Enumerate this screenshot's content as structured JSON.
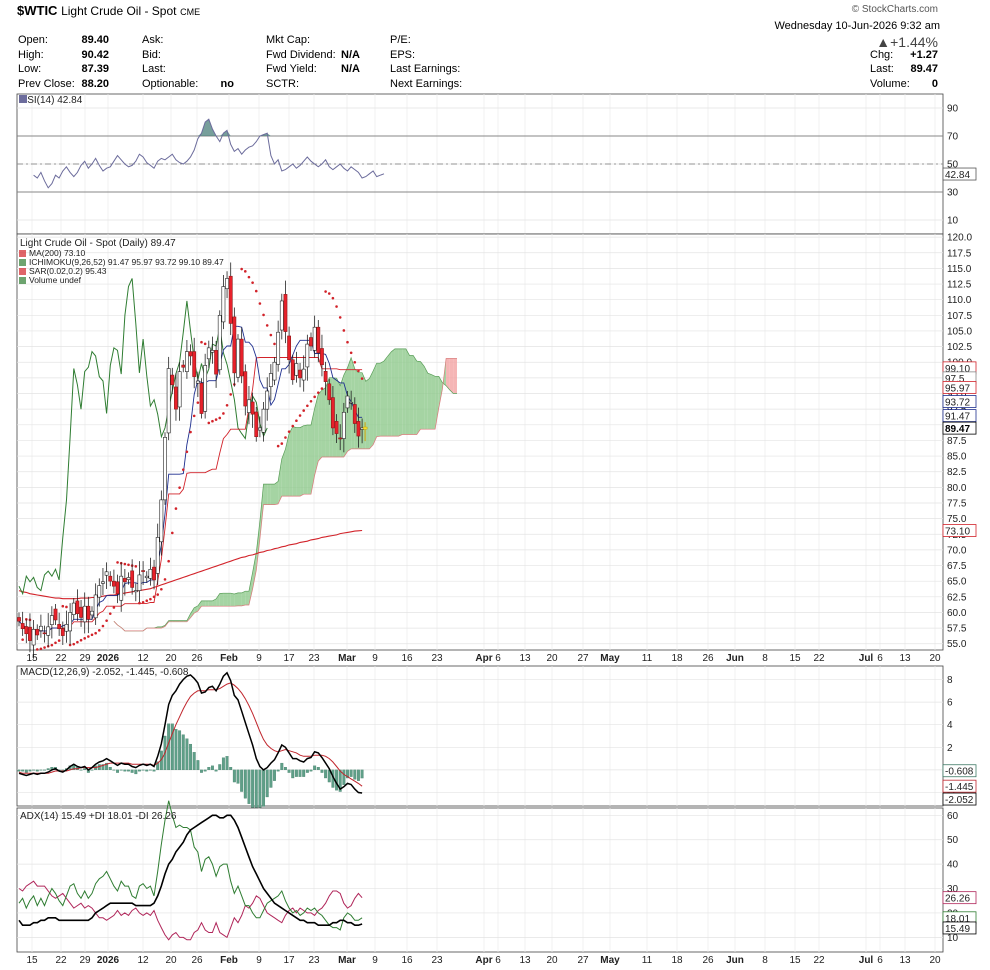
{
  "header": {
    "symbol": "$WTIC",
    "name": "Light Crude Oil - Spot",
    "exchange": "CME",
    "brand": "© StockCharts.com",
    "date": "Wednesday  10-Jun-2026  9:32 am",
    "pct_change": "▲+1.44%",
    "col1": [
      [
        "Open:",
        "89.40"
      ],
      [
        "High:",
        "90.42"
      ],
      [
        "Low:",
        "87.39"
      ],
      [
        "Prev Close:",
        "88.20"
      ]
    ],
    "col2": [
      [
        "Ask:",
        ""
      ],
      [
        "Bid:",
        ""
      ],
      [
        "Last:",
        ""
      ],
      [
        "Optionable:",
        "no"
      ]
    ],
    "col3": [
      [
        "Mkt Cap:",
        ""
      ],
      [
        "Fwd Dividend:",
        "N/A"
      ],
      [
        "Fwd Yield:",
        "N/A"
      ],
      [
        "SCTR:",
        ""
      ]
    ],
    "col4": [
      [
        "P/E:",
        ""
      ],
      [
        "EPS:",
        ""
      ],
      [
        "Last Earnings:",
        ""
      ],
      [
        "Next Earnings:",
        ""
      ]
    ],
    "col5": [
      [
        "Chg:",
        "+1.27"
      ],
      [
        "Last:",
        "89.47"
      ],
      [
        "Volume:",
        "0"
      ]
    ]
  },
  "colors": {
    "up": "#ffffff",
    "down": "#e8212b",
    "ma200": "#d2232a",
    "tenkan": "#1e2f8f",
    "kijun": "#d2232a",
    "chikou": "#2f7d32",
    "cloud_up": "#8fc98c",
    "cloud_down": "#f2a3a3",
    "sar": "#d2232a",
    "macd": "#000000",
    "signal": "#c0262d",
    "hist": "#5f9f88",
    "adx": "#000000",
    "pdi": "#2f7d32",
    "ndi": "#b0265a",
    "rsi": "#6c6c9c",
    "highlight": "#ffef3a"
  },
  "chart_data": [
    {
      "type": "line",
      "title": "RSI(14) 42.84",
      "series": [
        {
          "name": "RSI(14)",
          "values": [
            42,
            40,
            44,
            38,
            33,
            36,
            42,
            40,
            45,
            48,
            44,
            41,
            44,
            49,
            52,
            47,
            50,
            54,
            49,
            45,
            47,
            48,
            52,
            56,
            53,
            50,
            48,
            49,
            52,
            57,
            55,
            51,
            49,
            47,
            52,
            54,
            53,
            55,
            57,
            53,
            51,
            50,
            52,
            55,
            60,
            68,
            72,
            80,
            82,
            75,
            70,
            66,
            72,
            74,
            64,
            59,
            61,
            57,
            60,
            62,
            63,
            66,
            70,
            71,
            72,
            56,
            50,
            53,
            45,
            46,
            48,
            50,
            47,
            49,
            52,
            55,
            52,
            50,
            48,
            50,
            53,
            48,
            46,
            48,
            50,
            47,
            45,
            48,
            46,
            44,
            40,
            41,
            43,
            45,
            41,
            42,
            43
          ]
        }
      ],
      "y_ticks": [
        10,
        30,
        50,
        70,
        90
      ],
      "ylim": [
        0,
        100
      ],
      "last_label": "42.84"
    },
    {
      "type": "candlestick",
      "title": "Light Crude Oil - Spot (Daily) 89.47",
      "legend": [
        "MA(200) 73.10",
        "ICHIMOKU(9,26,52) 91.47 95.97 93.72 99.10 89.47",
        "SAR(0.02,0.2) 95.43",
        "Volume undef"
      ],
      "y_ticks": [
        55.0,
        57.5,
        60.0,
        62.5,
        65.0,
        67.5,
        70.0,
        72.5,
        75.0,
        77.5,
        80.0,
        82.5,
        85.0,
        87.5,
        90.0,
        92.5,
        95.0,
        97.5,
        100.0,
        102.5,
        105.0,
        107.5,
        110.0,
        112.5,
        115.0,
        117.5,
        120.0
      ],
      "ylim": [
        54,
        120.5
      ],
      "right_labels": [
        "99.10",
        "97.5",
        "95.97",
        "93.72",
        "91.47",
        "89.47",
        "73.10"
      ],
      "x_ticks": [
        "15",
        "22",
        "29",
        "2026",
        "12",
        "20",
        "26",
        "Feb",
        "9",
        "17",
        "23",
        "Mar",
        "9",
        "16",
        "23",
        "Apr",
        "6",
        "13",
        "20",
        "27",
        "May",
        "11",
        "18",
        "26",
        "Jun",
        "8",
        "15",
        "22",
        "Jul",
        "6",
        "13",
        "20"
      ],
      "closes": [
        58.6,
        57.4,
        56.6,
        55.5,
        57.3,
        56.4,
        57.8,
        56.7,
        57.7,
        59.5,
        58.8,
        57.4,
        56.3,
        58.1,
        60.0,
        61.5,
        59.8,
        59.2,
        61.0,
        58.9,
        60.2,
        62.8,
        64.3,
        64.9,
        66.5,
        65.0,
        64.2,
        63.0,
        65.8,
        64.9,
        65.6,
        64.0,
        63.5,
        66.0,
        66.6,
        65.8,
        66.9,
        65.2,
        72.0,
        78.0,
        88.0,
        99.0,
        96.4,
        92.5,
        98.5,
        99.2,
        101.7,
        101.0,
        97.7,
        97.0,
        91.8,
        99.5,
        102.3,
        101.9,
        98.1,
        107.5,
        112.1,
        113.4,
        106.2,
        98.3,
        103.7,
        97.8,
        93.0,
        94.0,
        91.7,
        88.1,
        89.5,
        92.5,
        95.4,
        98.2,
        100.0,
        104.8,
        109.8,
        104.9,
        100.4,
        97.2,
        99.8,
        97.5,
        98.9,
        102.9,
        102.6,
        105.6,
        101.5,
        99.6,
        96.9,
        94.0,
        89.5,
        88.6,
        87.8,
        92.0,
        94.6,
        93.6,
        90.2,
        88.2,
        89.5
      ],
      "ma200": [
        63.5,
        63.3,
        63.2,
        63.0,
        62.9,
        62.8,
        62.7,
        62.6,
        62.5,
        62.4,
        62.3,
        62.3,
        62.2,
        62.2,
        62.2,
        62.2,
        62.2,
        62.3,
        62.3,
        62.3,
        62.4,
        62.4,
        62.5,
        62.6,
        62.7,
        62.8,
        62.8,
        62.9,
        63.0,
        63.1,
        63.2,
        63.3,
        63.4,
        63.5,
        63.6,
        63.7,
        63.8,
        64.0,
        64.2,
        64.4,
        64.6,
        64.8,
        65.0,
        65.2,
        65.4,
        65.6,
        65.8,
        66.0,
        66.2,
        66.4,
        66.6,
        66.8,
        67.0,
        67.2,
        67.4,
        67.6,
        67.8,
        68.0,
        68.2,
        68.4,
        68.6,
        68.8,
        68.9,
        69.1,
        69.2,
        69.4,
        69.6,
        69.7,
        69.9,
        70.0,
        70.2,
        70.3,
        70.5,
        70.6,
        70.8,
        70.9,
        71.0,
        71.2,
        71.3,
        71.4,
        71.6,
        71.7,
        71.8,
        72.0,
        72.1,
        72.2,
        72.3,
        72.4,
        72.6,
        72.7,
        72.8,
        72.9,
        73.0,
        73.05,
        73.1
      ],
      "last": 89.47,
      "ma200_last": 73.1
    },
    {
      "type": "bar+line",
      "title": "MACD(12,26,9) -2.052, -1.445, -0.608",
      "series": [
        {
          "name": "MACD(12,26,9)",
          "values": [
            -0.3,
            -0.4,
            -0.5,
            -0.4,
            -0.3,
            -0.4,
            -0.3,
            -0.3,
            -0.2,
            0.0,
            0.1,
            -0.1,
            -0.2,
            0.0,
            0.3,
            0.5,
            0.3,
            0.2,
            0.3,
            0.0,
            0.2,
            0.5,
            0.7,
            0.8,
            1.0,
            0.8,
            0.6,
            0.4,
            0.6,
            0.5,
            0.5,
            0.3,
            0.2,
            0.4,
            0.5,
            0.4,
            0.5,
            0.3,
            1.2,
            2.3,
            4.0,
            5.8,
            6.6,
            7.0,
            7.6,
            8.0,
            8.3,
            8.4,
            8.1,
            7.7,
            6.8,
            6.9,
            7.3,
            7.4,
            7.0,
            7.6,
            8.3,
            8.6,
            7.9,
            6.6,
            6.2,
            5.2,
            4.2,
            3.2,
            2.2,
            1.0,
            0.3,
            0.0,
            0.2,
            0.6,
            0.9,
            1.5,
            2.2,
            2.0,
            1.5,
            1.0,
            1.0,
            0.8,
            0.7,
            1.0,
            1.1,
            1.6,
            1.5,
            1.1,
            0.6,
            0.1,
            -0.6,
            -1.2,
            -1.7,
            -1.5,
            -1.2,
            -1.3,
            -1.7,
            -2.0,
            -2.05
          ]
        },
        {
          "name": "Signal",
          "values": [
            -0.2,
            -0.3,
            -0.3,
            -0.3,
            -0.3,
            -0.3,
            -0.3,
            -0.3,
            -0.3,
            -0.2,
            -0.1,
            -0.1,
            -0.1,
            -0.1,
            0.0,
            0.1,
            0.1,
            0.2,
            0.2,
            0.2,
            0.2,
            0.2,
            0.3,
            0.4,
            0.5,
            0.6,
            0.6,
            0.6,
            0.6,
            0.6,
            0.6,
            0.5,
            0.5,
            0.5,
            0.5,
            0.5,
            0.5,
            0.4,
            0.6,
            0.9,
            1.5,
            2.4,
            3.2,
            4.0,
            4.7,
            5.4,
            6.0,
            6.5,
            6.8,
            7.0,
            7.0,
            7.0,
            7.1,
            7.1,
            7.1,
            7.2,
            7.4,
            7.6,
            7.7,
            7.5,
            7.2,
            6.8,
            6.3,
            5.7,
            5.0,
            4.2,
            3.4,
            2.7,
            2.2,
            1.9,
            1.7,
            1.6,
            1.7,
            1.8,
            1.7,
            1.6,
            1.5,
            1.3,
            1.2,
            1.2,
            1.2,
            1.3,
            1.3,
            1.3,
            1.2,
            1.0,
            0.7,
            0.3,
            -0.1,
            -0.4,
            -0.6,
            -0.8,
            -1.0,
            -1.2,
            -1.445
          ]
        },
        {
          "name": "Histogram",
          "values": []
        }
      ],
      "y_ticks": [
        -2,
        0,
        2,
        4,
        6,
        8
      ],
      "ylim": [
        -3.2,
        9.2
      ],
      "right_labels": [
        "-0.608",
        "-1.445",
        "-2.052"
      ]
    },
    {
      "type": "line",
      "title": "ADX(14) 15.49 +DI 18.01 -DI 26.26",
      "series": [
        {
          "name": "ADX(14)",
          "values": [
            17,
            15,
            15,
            15,
            16,
            16,
            17,
            17,
            18,
            18,
            18,
            17,
            17,
            17,
            17,
            17,
            17,
            17,
            17,
            17,
            18,
            20,
            21,
            22,
            23,
            24,
            24,
            24,
            24,
            24,
            24,
            24,
            23,
            23,
            23,
            23,
            23,
            24,
            27,
            31,
            36,
            40,
            42,
            45,
            47,
            49,
            52,
            54,
            55,
            56,
            57,
            58,
            59,
            60,
            60,
            59,
            59,
            60,
            60,
            58,
            55,
            51,
            47,
            43,
            39,
            36,
            33,
            30,
            28,
            26,
            24,
            23,
            22,
            21,
            20,
            19,
            18,
            17,
            17,
            16,
            16,
            16,
            15,
            15,
            15,
            15,
            16,
            16,
            17,
            17,
            16,
            16,
            15,
            15,
            15.49
          ]
        },
        {
          "name": "+DI",
          "values": [
            24,
            26,
            22,
            25,
            27,
            23,
            26,
            23,
            27,
            30,
            28,
            25,
            23,
            27,
            31,
            32,
            28,
            26,
            29,
            26,
            28,
            32,
            34,
            35,
            37,
            34,
            31,
            29,
            33,
            31,
            31,
            27,
            26,
            31,
            32,
            30,
            31,
            27,
            37,
            48,
            58,
            66,
            60,
            55,
            56,
            55,
            55,
            54,
            47,
            45,
            37,
            42,
            43,
            40,
            35,
            39,
            40,
            40,
            33,
            28,
            31,
            27,
            23,
            23,
            20,
            18,
            18,
            21,
            24,
            25,
            26,
            27,
            29,
            25,
            22,
            20,
            21,
            19,
            20,
            22,
            21,
            22,
            20,
            19,
            17,
            15,
            14,
            14,
            13,
            18,
            20,
            19,
            17,
            17,
            18.01
          ]
        },
        {
          "name": "-DI",
          "values": [
            30,
            29,
            31,
            32,
            33,
            31,
            31,
            31,
            29,
            27,
            26,
            27,
            28,
            26,
            24,
            22,
            23,
            24,
            22,
            23,
            22,
            20,
            18,
            18,
            17,
            18,
            19,
            21,
            19,
            20,
            19,
            21,
            22,
            20,
            19,
            20,
            19,
            21,
            17,
            14,
            11,
            9,
            11,
            12,
            10,
            10,
            9,
            9,
            12,
            13,
            16,
            13,
            12,
            12,
            16,
            12,
            11,
            10,
            14,
            18,
            16,
            19,
            23,
            22,
            24,
            27,
            26,
            23,
            20,
            19,
            18,
            17,
            16,
            19,
            21,
            22,
            20,
            22,
            21,
            20,
            20,
            19,
            21,
            22,
            24,
            27,
            29,
            29,
            28,
            24,
            22,
            23,
            26,
            28,
            26.26
          ]
        }
      ],
      "y_ticks": [
        10,
        20,
        30,
        40,
        50,
        60
      ],
      "ylim": [
        4,
        63
      ],
      "right_labels": [
        "26.26",
        "18.01",
        "15.49"
      ]
    }
  ]
}
